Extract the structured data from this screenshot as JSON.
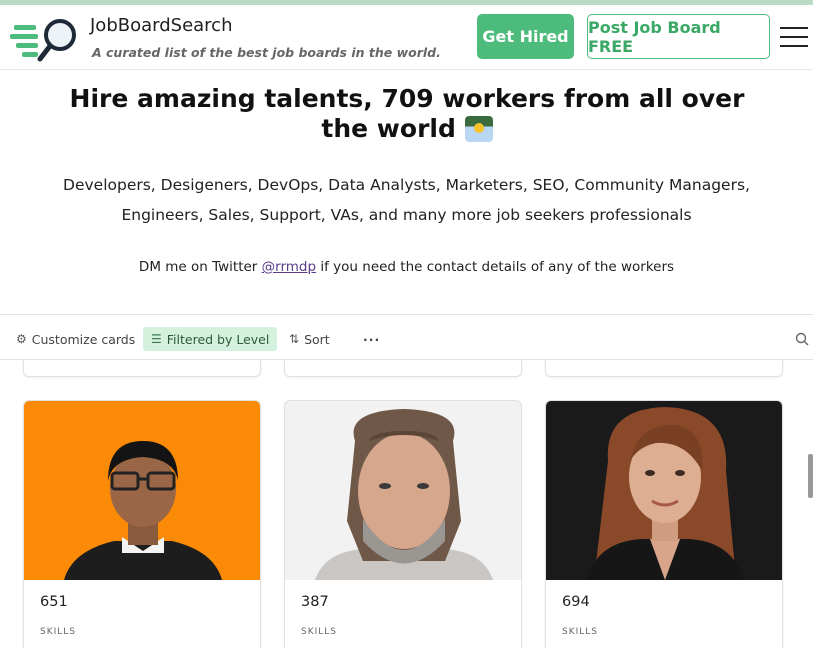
{
  "header": {
    "brand_name": "JobBoardSearch",
    "tagline": "A curated list of the best job boards in the world.",
    "get_hired_label": "Get Hired",
    "post_label": "Post Job Board FREE",
    "accent_color": "#4dbb7b"
  },
  "hero": {
    "title": "Hire amazing talents, 709 workers from all over the world",
    "subtitle": "Developers, Desigeners, DevOps, Data Analysts, Marketers, SEO, Community Managers, Engineers, Sales, Support, VAs, and many more job seekers professionals",
    "dm_prefix": "DM me on Twitter",
    "dm_link": "@rrmdp",
    "dm_suffix": "if you need the contact details of any of the workers"
  },
  "toolbar": {
    "customize_label": "Customize cards",
    "filter_label": "Filtered by Level",
    "sort_label": "Sort",
    "more_label": "···"
  },
  "cards": [
    {
      "number": "651",
      "label": "SKILLS"
    },
    {
      "number": "387",
      "label": "SKILLS"
    },
    {
      "number": "694",
      "label": "SKILLS"
    }
  ]
}
